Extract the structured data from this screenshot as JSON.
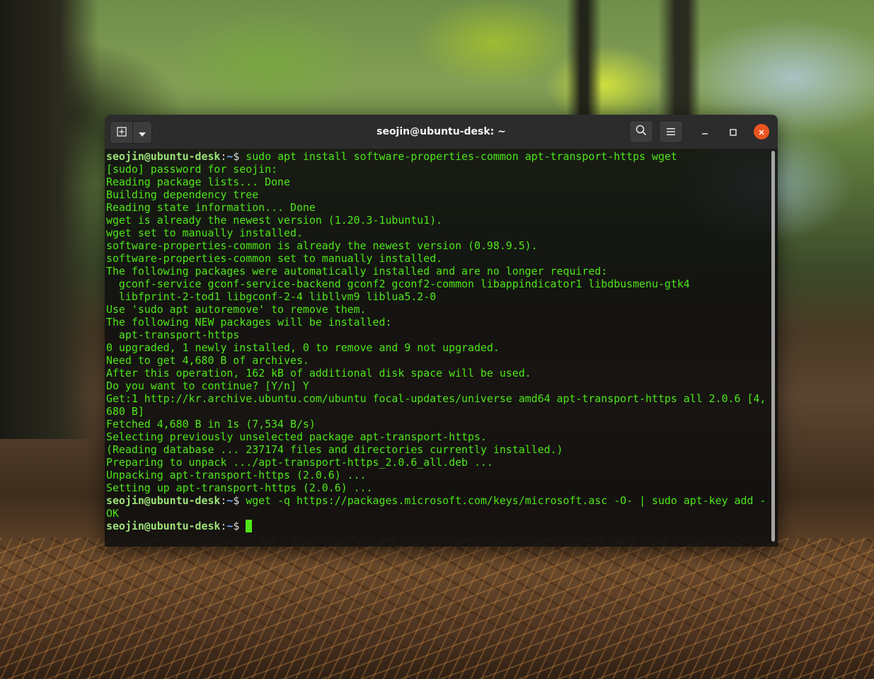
{
  "window": {
    "title": "seojin@ubuntu-desk: ~"
  },
  "colors": {
    "terminal_text": "#4ee619",
    "close_button": "#e95420",
    "titlebar": "#2c2c2c"
  },
  "icons": {
    "new_tab": "new-tab-icon",
    "dropdown": "chevron-down-icon",
    "search": "search-icon",
    "menu": "hamburger-menu-icon",
    "minimize": "minimize-icon",
    "maximize": "maximize-icon",
    "close": "close-icon"
  },
  "prompt": {
    "user_host": "seojin@ubuntu-desk",
    "separator": ":",
    "path": "~",
    "symbol": "$"
  },
  "terminal": {
    "lines": [
      {
        "type": "cmd",
        "text": "sudo apt install software-properties-common apt-transport-https wget"
      },
      {
        "type": "out",
        "text": "[sudo] password for seojin:"
      },
      {
        "type": "out",
        "text": "Reading package lists... Done"
      },
      {
        "type": "out",
        "text": "Building dependency tree"
      },
      {
        "type": "out",
        "text": "Reading state information... Done"
      },
      {
        "type": "out",
        "text": "wget is already the newest version (1.20.3-1ubuntu1)."
      },
      {
        "type": "out",
        "text": "wget set to manually installed."
      },
      {
        "type": "out",
        "text": "software-properties-common is already the newest version (0.98.9.5)."
      },
      {
        "type": "out",
        "text": "software-properties-common set to manually installed."
      },
      {
        "type": "out",
        "text": "The following packages were automatically installed and are no longer required:"
      },
      {
        "type": "out",
        "text": "  gconf-service gconf-service-backend gconf2 gconf2-common libappindicator1 libdbusmenu-gtk4"
      },
      {
        "type": "out",
        "text": "  libfprint-2-tod1 libgconf-2-4 libllvm9 liblua5.2-0"
      },
      {
        "type": "out",
        "text": "Use 'sudo apt autoremove' to remove them."
      },
      {
        "type": "out",
        "text": "The following NEW packages will be installed:"
      },
      {
        "type": "out",
        "text": "  apt-transport-https"
      },
      {
        "type": "out",
        "text": "0 upgraded, 1 newly installed, 0 to remove and 9 not upgraded."
      },
      {
        "type": "out",
        "text": "Need to get 4,680 B of archives."
      },
      {
        "type": "out",
        "text": "After this operation, 162 kB of additional disk space will be used."
      },
      {
        "type": "out",
        "text": "Do you want to continue? [Y/n] Y"
      },
      {
        "type": "out",
        "text": "Get:1 http://kr.archive.ubuntu.com/ubuntu focal-updates/universe amd64 apt-transport-https all 2.0.6 [4,"
      },
      {
        "type": "out",
        "text": "680 B]"
      },
      {
        "type": "out",
        "text": "Fetched 4,680 B in 1s (7,534 B/s)"
      },
      {
        "type": "out",
        "text": "Selecting previously unselected package apt-transport-https."
      },
      {
        "type": "out",
        "text": "(Reading database ... 237174 files and directories currently installed.)"
      },
      {
        "type": "out",
        "text": "Preparing to unpack .../apt-transport-https_2.0.6_all.deb ..."
      },
      {
        "type": "out",
        "text": "Unpacking apt-transport-https (2.0.6) ..."
      },
      {
        "type": "out",
        "text": "Setting up apt-transport-https (2.0.6) ..."
      },
      {
        "type": "cmd",
        "text": "wget -q https://packages.microsoft.com/keys/microsoft.asc -O- | sudo apt-key add -"
      },
      {
        "type": "out",
        "text": "OK"
      },
      {
        "type": "cmd",
        "text": "",
        "cursor": true
      }
    ]
  }
}
